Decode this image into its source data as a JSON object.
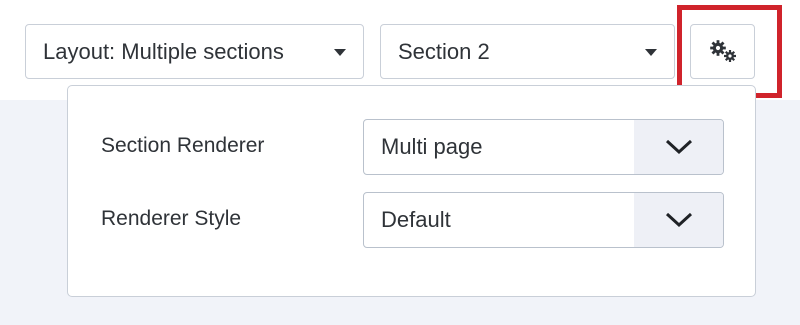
{
  "toolbar": {
    "layout_label": "Layout: Multiple sections",
    "section_label": "Section 2",
    "settings_icon": "gears-icon"
  },
  "settings_panel": {
    "rows": [
      {
        "label": "Section Renderer",
        "value": "Multi page"
      },
      {
        "label": "Renderer Style",
        "value": "Default"
      }
    ]
  },
  "colors": {
    "highlight": "#d0232b",
    "page_background": "#f1f3f9",
    "select_arrow_bg": "#eef0f6"
  }
}
